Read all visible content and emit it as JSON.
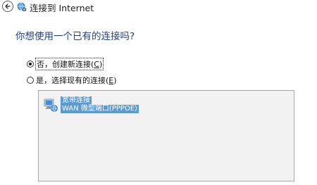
{
  "window": {
    "title": "连接到 Internet"
  },
  "question": "你想使用一个已有的连接吗?",
  "options": [
    {
      "label": "否，创建新连接(",
      "mnemonic": "C",
      "suffix": ")",
      "selected": true
    },
    {
      "label": "是，选择现有的连接(",
      "mnemonic": "E",
      "suffix": ")",
      "selected": false
    }
  ],
  "connections": [
    {
      "name": "宽带连接",
      "device": "WAN 微型端口(PPPOE)",
      "icon": "network-connection-icon",
      "selected": true
    }
  ],
  "colors": {
    "heading": "#1f3f8f",
    "selection": "#5b9bd5",
    "list_background": "#f2f2f2"
  }
}
